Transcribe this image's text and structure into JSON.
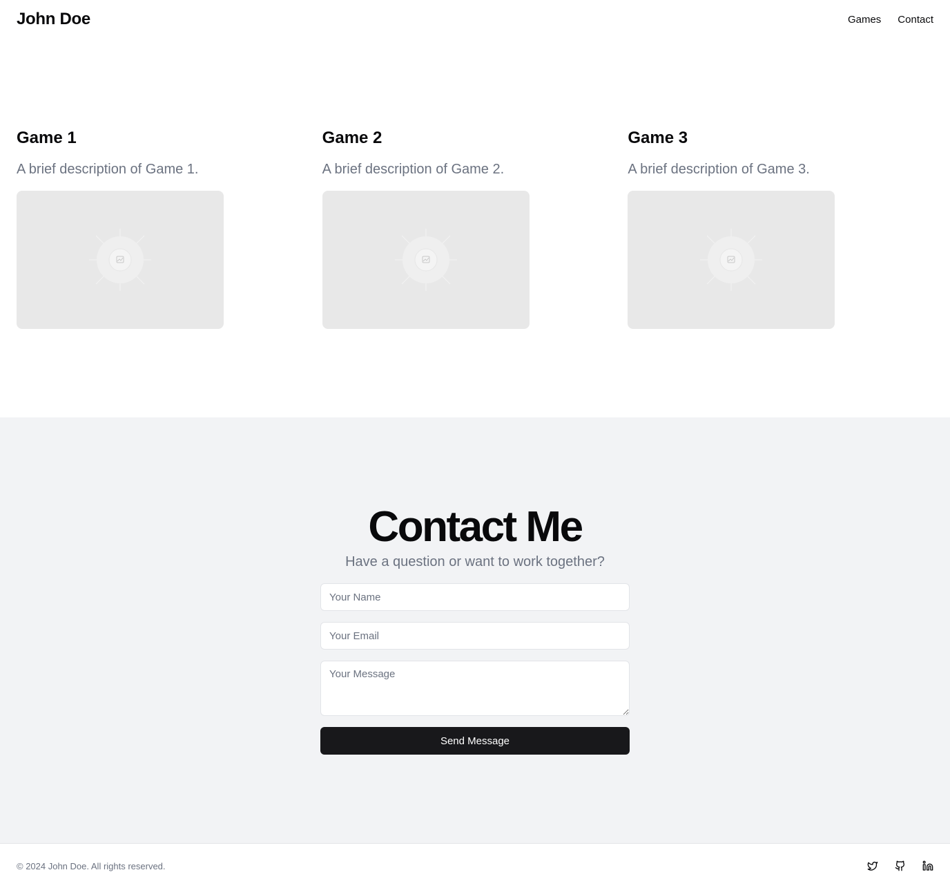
{
  "header": {
    "brand": "John Doe",
    "nav": [
      "Games",
      "Contact"
    ]
  },
  "games": [
    {
      "title": "Game 1",
      "description": "A brief description of Game 1."
    },
    {
      "title": "Game 2",
      "description": "A brief description of Game 2."
    },
    {
      "title": "Game 3",
      "description": "A brief description of Game 3."
    }
  ],
  "contact": {
    "title": "Contact Me",
    "subtitle": "Have a question or want to work together?",
    "name_placeholder": "Your Name",
    "email_placeholder": "Your Email",
    "message_placeholder": "Your Message",
    "submit_label": "Send Message"
  },
  "footer": {
    "copyright": "© 2024 John Doe. All rights reserved.",
    "social_icons": [
      "twitter-icon",
      "github-icon",
      "linkedin-icon"
    ]
  },
  "colors": {
    "accent_dark": "#18181b",
    "muted_text": "#6b7280",
    "section_bg": "#f2f3f5",
    "placeholder_bg": "#e8e8e8"
  }
}
